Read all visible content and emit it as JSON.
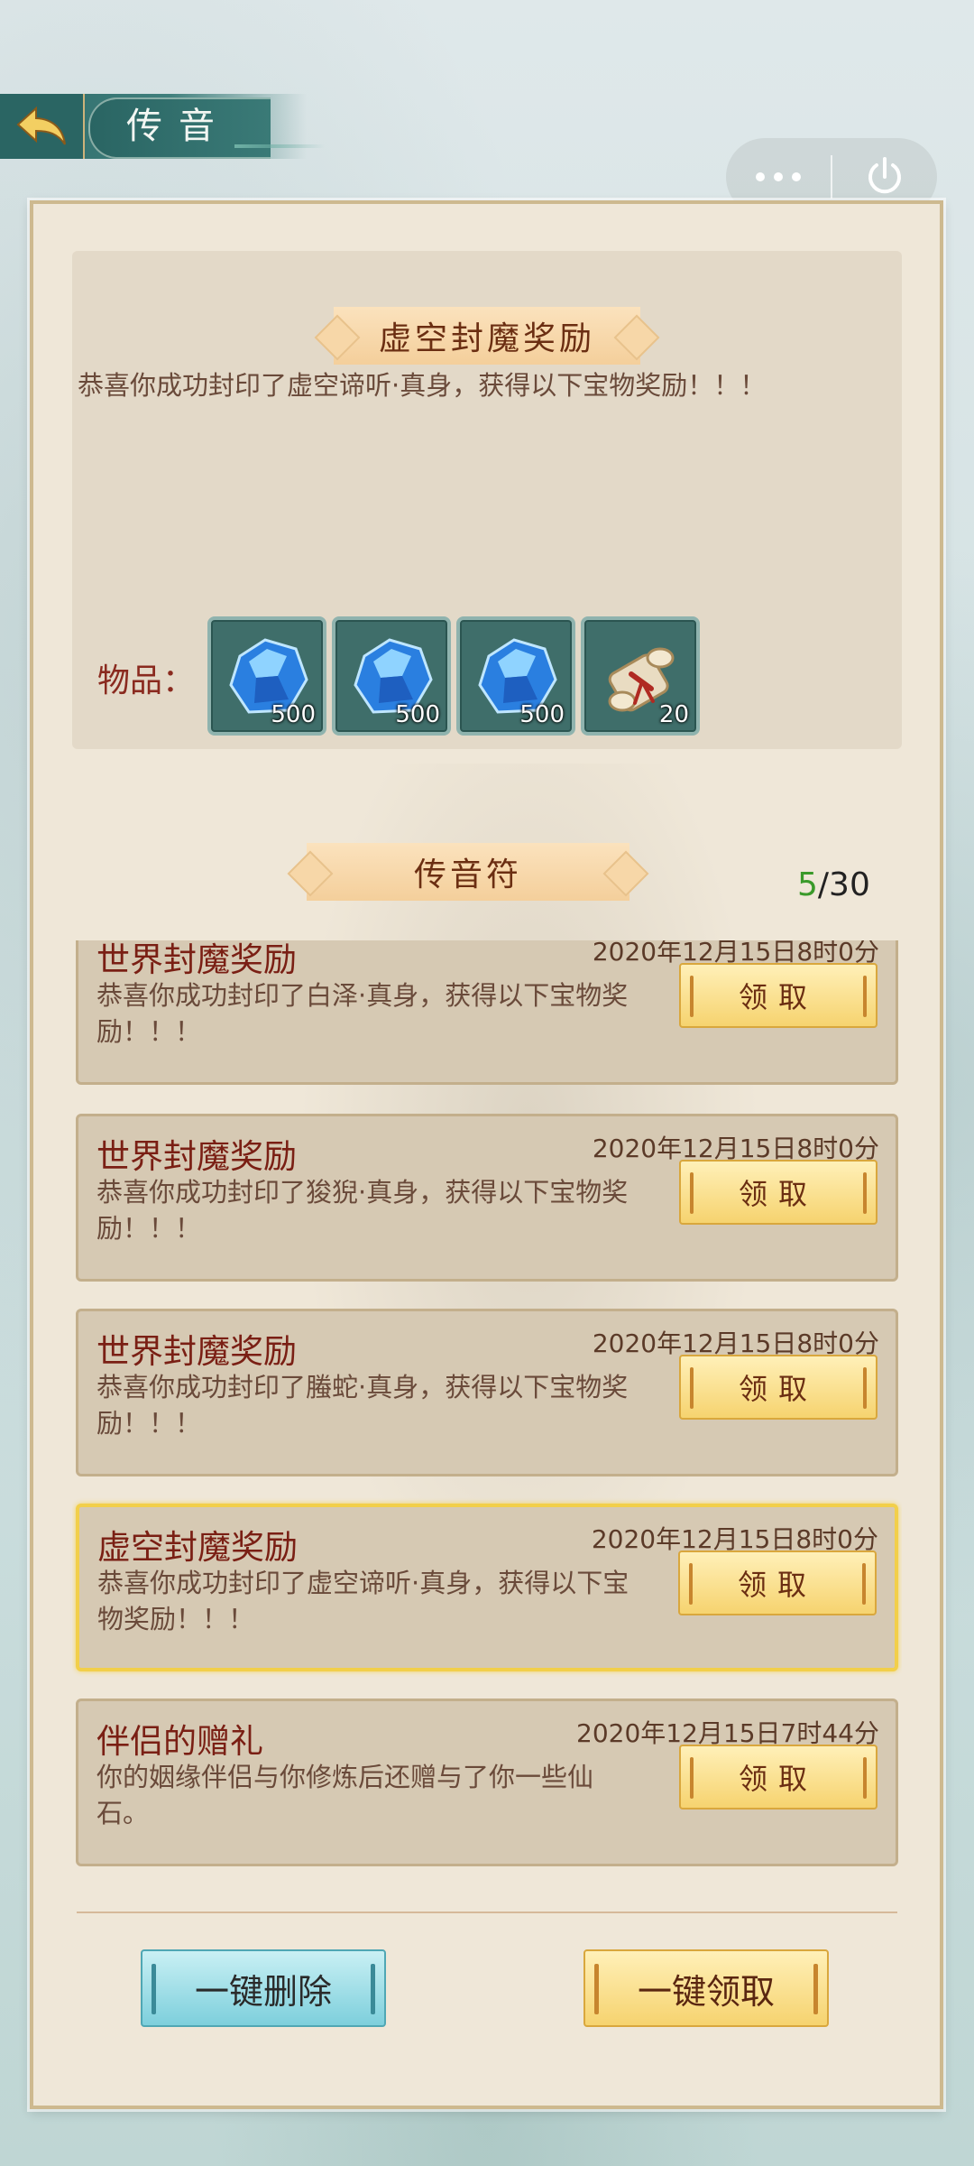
{
  "header": {
    "title": "传音",
    "back_icon": "back-arrow-icon",
    "more_icon": "more-dots-icon",
    "power_icon": "power-icon"
  },
  "detail": {
    "ribbon_title": "虚空封魔奖励",
    "message": "恭喜你成功封印了虚空谛听·真身，获得以下宝物奖励！！！",
    "items_label": "物品：",
    "items": [
      {
        "icon": "blue-gem-icon",
        "count": "500"
      },
      {
        "icon": "blue-gem-icon",
        "count": "500"
      },
      {
        "icon": "blue-gem-icon",
        "count": "500"
      },
      {
        "icon": "scroll-icon",
        "count": "20"
      }
    ]
  },
  "list": {
    "ribbon_title": "传音符",
    "counter_current": "5",
    "counter_total": "/30",
    "claim_label": "领取",
    "mails": [
      {
        "title": "世界封魔奖励",
        "time": "2020年12月15日8时0分",
        "body": "恭喜你成功封印了白泽·真身，获得以下宝物奖励！！！"
      },
      {
        "title": "世界封魔奖励",
        "time": "2020年12月15日8时0分",
        "body": "恭喜你成功封印了狻猊·真身，获得以下宝物奖励！！！"
      },
      {
        "title": "世界封魔奖励",
        "time": "2020年12月15日8时0分",
        "body": "恭喜你成功封印了螣蛇·真身，获得以下宝物奖励！！！"
      },
      {
        "title": "虚空封魔奖励",
        "time": "2020年12月15日8时0分",
        "body": "恭喜你成功封印了虚空谛听·真身，获得以下宝物奖励！！！"
      },
      {
        "title": "伴侣的赠礼",
        "time": "2020年12月15日7时44分",
        "body": "你的姻缘伴侣与你修炼后还赠与了你一些仙石。"
      }
    ]
  },
  "footer": {
    "delete_all_label": "一键删除",
    "claim_all_label": "一键领取"
  },
  "colors": {
    "accent_red": "#7a1f14",
    "gold_button": "#f6d36f",
    "teal_button": "#7dcfdc",
    "counter_green": "#3a9a2a"
  }
}
